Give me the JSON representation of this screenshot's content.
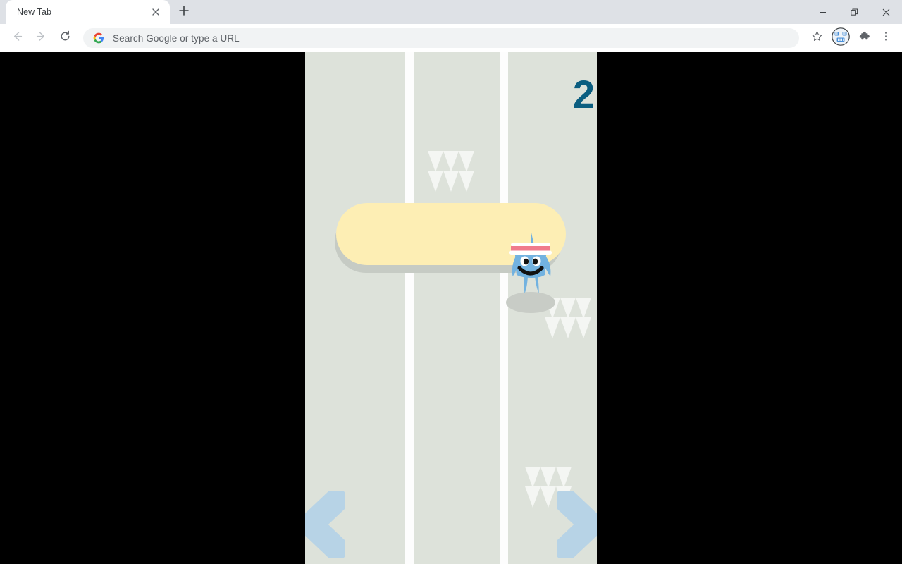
{
  "window": {
    "controls": [
      {
        "name": "minimize-button",
        "icon": "minimize-icon"
      },
      {
        "name": "maximize-button",
        "icon": "maximize-icon"
      },
      {
        "name": "close-button",
        "icon": "close-icon"
      }
    ]
  },
  "tabs": [
    {
      "title": "New Tab",
      "active": true,
      "close_icon": "close-icon"
    }
  ],
  "new_tab_button": {
    "icon": "plus-icon",
    "label": "New Tab"
  },
  "toolbar": {
    "back": {
      "icon": "arrow-left-icon",
      "label": "Back"
    },
    "forward": {
      "icon": "arrow-right-icon",
      "label": "Forward"
    },
    "reload": {
      "icon": "reload-icon",
      "label": "Reload"
    },
    "omnibox": {
      "icon": "google-g-icon",
      "value": "",
      "placeholder": "Search Google or type a URL"
    },
    "bookmark": {
      "icon": "star-icon",
      "label": "Bookmark this tab"
    },
    "profile": {
      "icon": "avatar-icon",
      "label": "Profile"
    },
    "extensions": {
      "icon": "puzzle-piece-icon",
      "label": "Extensions"
    },
    "menu": {
      "icon": "three-dot-menu-icon",
      "label": "Customize and control Google Chrome"
    }
  },
  "game": {
    "name": "lane-runner-doodle",
    "score": "2",
    "score_color": "#0b5e80",
    "background_color": "#dde2da",
    "lane_divider_color": "#fdfdfd",
    "letterbox_color": "#000000",
    "lanes": 3,
    "player": {
      "name": "star-character",
      "lane": 3,
      "body_color": "#72b2e0",
      "hat_band_color": "#f07a8c",
      "hat_color": "#ffffff",
      "shadow_color": "#c8ccc6"
    },
    "obstacle": {
      "name": "yellow-bar-obstacle",
      "color": "#fdeeb4",
      "shadow_color": "#c6cbc4"
    },
    "decorations": [
      {
        "name": "wheat-chevrons",
        "position": "top-center",
        "color": "#f4f6f3"
      },
      {
        "name": "wheat-chevrons",
        "position": "mid-right",
        "color": "#f4f6f3"
      },
      {
        "name": "wheat-chevrons",
        "position": "bottom-right",
        "color": "#f4f6f3"
      }
    ],
    "controls": {
      "left": {
        "name": "move-left-arrow",
        "icon": "chevron-left-icon",
        "color": "#b7d3e6"
      },
      "right": {
        "name": "move-right-arrow",
        "icon": "chevron-right-icon",
        "color": "#b7d3e6"
      }
    }
  }
}
